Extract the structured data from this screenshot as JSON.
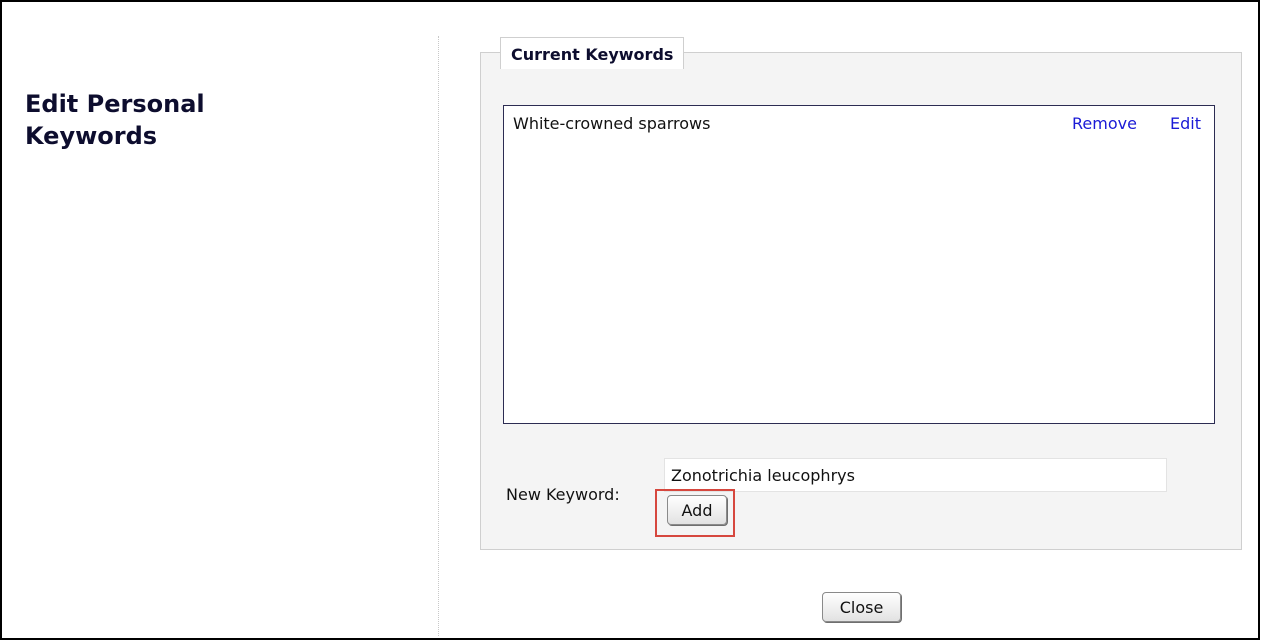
{
  "page": {
    "title": "Edit Personal Keywords"
  },
  "current_keywords": {
    "legend": "Current Keywords",
    "items": [
      {
        "text": "White-crowned sparrows",
        "remove_label": "Remove",
        "edit_label": "Edit"
      }
    ]
  },
  "new_keyword": {
    "label": "New Keyword:",
    "value": "Zonotrichia leucophrys",
    "add_label": "Add"
  },
  "footer": {
    "close_label": "Close"
  },
  "colors": {
    "link": "#1a1ad6",
    "heading": "#0d0d2e",
    "highlight": "#d6473e",
    "panel_bg": "#f4f4f4"
  }
}
